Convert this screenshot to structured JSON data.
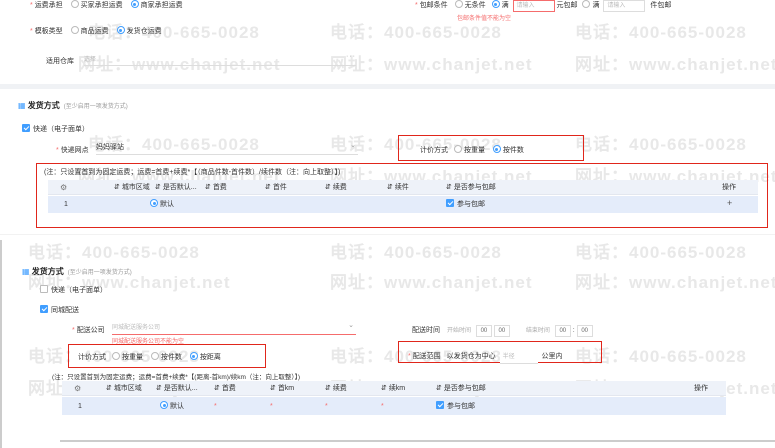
{
  "watermark": {
    "phone": "电话：400-665-0028",
    "url": "网址：www.chanjet.net"
  },
  "top": {
    "freight_bearer": {
      "label": "运费承担",
      "options": [
        "买家承担运费",
        "商家承担运费"
      ]
    },
    "template_type": {
      "label": "模板类型",
      "options": [
        "商品运费",
        "发货仓运费"
      ]
    },
    "warehouse": {
      "label": "适用仓库",
      "placeholder": "选择"
    },
    "free_shipping": {
      "label": "包邮条件",
      "opt1": "无条件",
      "opt2": "满",
      "ph1": "请输入",
      "unit1": "元包邮",
      "opt3": "满",
      "ph2": "请输入",
      "unit2": "件包邮",
      "error": "包邮条件值不能为空"
    }
  },
  "section1": {
    "title": "发货方式",
    "hint": "(至少启用一项发货方式)",
    "express_label": "快递（电子面单）",
    "outlet_label": "快递网点",
    "outlet_value": "妈妈驿站",
    "calc_label": "计价方式",
    "calc_options": [
      "按重量",
      "按件数"
    ],
    "note": "(注：只设置首到为固定运费；运费=首费+续费*【（商品件数-首件数）/续件数（注：向上取整）】)",
    "columns": [
      "城市区域",
      "是否默认...",
      "首费",
      "首件",
      "续费",
      "续件",
      "是否参与包邮",
      "操作"
    ],
    "row": {
      "index": "1",
      "default": "默认",
      "free": "参与包邮",
      "op": "+"
    }
  },
  "section2": {
    "title": "发货方式",
    "hint": "(至少启用一项发货方式)",
    "express_label": "快递（电子面单）",
    "city_label": "同城配送",
    "company_label": "配送公司",
    "company_placeholder": "同城配送服务公司",
    "company_error": "同城配送服务公司不能为空",
    "time_label": "配送时间",
    "start_label": "开始时间",
    "end_label": "结束时间",
    "time_h": "00",
    "time_m": "00",
    "calc_label": "计价方式",
    "calc_options": [
      "按重量",
      "按件数",
      "按距离"
    ],
    "range_label": "配送范围",
    "range_text": "以发货仓为中心",
    "range_placeholder": "半径",
    "range_unit": "公里内",
    "note": "(注：只设置首到为固定运费；运费=首费+续费*【(距离-首km)/续km（注：向上取整）】)",
    "columns": [
      "城市区域",
      "是否默认...",
      "首费",
      "首km",
      "续费",
      "续km",
      "是否参与包邮",
      "操作"
    ],
    "row": {
      "index": "1",
      "default": "默认",
      "star": "*",
      "free": "参与包邮"
    }
  }
}
